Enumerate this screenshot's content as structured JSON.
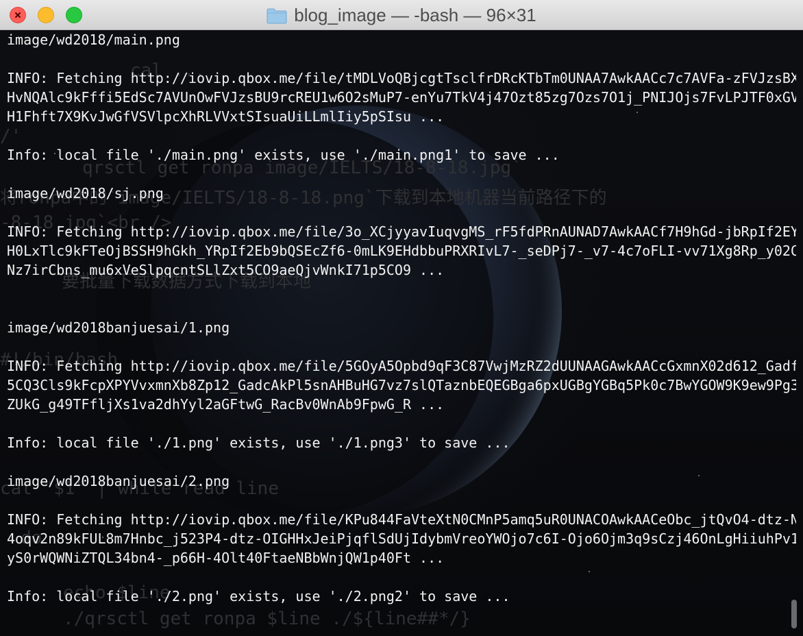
{
  "window": {
    "title": "blog_image — -bash — 96×31"
  },
  "background_text": [
    "cal ...",
    "/'",
    "qrsctl get ronpa image/IELTS/18-8-18.jpg`",
    "将ronpa中的`image/IELTS/18-8-18.png`下载到本地机器当前路径下的",
    "-8-18.jpg`<br />",
    "要批量下载数据方式下载到本地",
    "#!/bin/bash",
    "cat \"$1\" | while read line",
    "do",
    "echo $line",
    "./qrsctl get ronpa $line ./${line##*/}"
  ],
  "terminal": {
    "lines": [
      "image/wd2018/main.png",
      "",
      "INFO: Fetching http://iovip.qbox.me/file/tMDLVoQBjcgtTsclfrDRcKTbTm0UNAA7AwkAACc7c7AVFa-zFVJzsBX",
      "HvNQAlc9kFffi5EdSc7AVUnOwFVJzsBU9rcREU1w6O2sMuP7-enYu7TkV4j47Ozt85zg7Ozs7O1j_PNIJOjs7FvLPJTF0xGV",
      "H1Fhft7X9KvJwGfVSVlpcXhRLVVxtSIsuaUiLLmlIiy5pSIsu ...",
      "",
      "Info: local file './main.png' exists, use './main.png1' to save ...",
      "",
      "image/wd2018/sj.png",
      "",
      "INFO: Fetching http://iovip.qbox.me/file/3o_XCjyyavIuqvgMS_rF5fdPRnAUNAD7AwkAACf7H9hGd-jbRpIf2EY",
      "H0LxTlc9kFTeOjBSSH9hGkh_YRpIf2Eb9bQSEcZf6-0mLK9EHdbbuPRXRIvL7-_seDPj7-_v7-4c7oFLI-vv71Xg8Rp_y02C",
      "Nz7irCbns_mu6xVeSlpqcntSLlZxt5CO9aeQjvWnkI71p5CO9 ...",
      "",
      "",
      "image/wd2018banjuesai/1.png",
      "",
      "INFO: Fetching http://iovip.qbox.me/file/5GOyA5Opbd9qF3C87VwjMzRZ2dUUNAAGAwkAACcGxmnX02d612_Gadf",
      "5CQ3Cls9kFcpXPYVvxmnXb8Zp12_GadcAkPl5snAHBuHG7vz7slQTaznbEQEGBga6pxUGBgYGBq5Pk0c7BwYGOW9K9ew9Pg3",
      "ZUkG_g49TFfljXs1va2dhYyl2aGFtwG_RacBv0WnAb9FpwG_R ...",
      "",
      "Info: local file './1.png' exists, use './1.png3' to save ...",
      "",
      "image/wd2018banjuesai/2.png",
      "",
      "INFO: Fetching http://iovip.qbox.me/file/KPu844FaVteXtN0CMnP5amq5uR0UNACOAwkAACeObc_jtQvO4-dtz-N",
      "4oqv2n89kFUL8m7Hnbc_j523P4-dtz-OIGHHxJeiPjqflSdUjIdybmVreoYWOjo7c6I-Ojo6Ojm3q9sCzj46OnLgHiiuhPv1",
      "yS0rWQWNiZTQL34bn4-_p66H-4Olt40FtaeNBbWnjQW1p40Ft ...",
      "",
      "Info: local file './2.png' exists, use './2.png2' to save ..."
    ]
  }
}
